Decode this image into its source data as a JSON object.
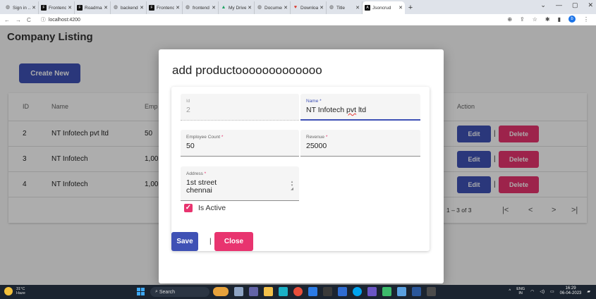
{
  "browser": {
    "tabs": [
      {
        "title": "Sign in ...",
        "icon": "globe-icon"
      },
      {
        "title": "Frontend",
        "icon": "square-logo-icon"
      },
      {
        "title": "Roadmap",
        "icon": "square-logo-icon"
      },
      {
        "title": "backend",
        "icon": "globe-icon"
      },
      {
        "title": "Frontend",
        "icon": "square-logo-icon"
      },
      {
        "title": "frontend",
        "icon": "globe-icon"
      },
      {
        "title": "My Drive",
        "icon": "drive-icon"
      },
      {
        "title": "Documen",
        "icon": "globe-icon"
      },
      {
        "title": "Downloa",
        "icon": "heart-icon"
      },
      {
        "title": "Title",
        "icon": "globe-icon"
      },
      {
        "title": "Jsoncrud",
        "icon": "angular-icon",
        "active": true
      }
    ],
    "url": "localhost:4200",
    "profile_initial": "b"
  },
  "page": {
    "title": "Company Listing",
    "create_label": "Create New"
  },
  "table": {
    "headers": {
      "id": "ID",
      "name": "Name",
      "emp": "Emp",
      "action": "Action"
    },
    "rows": [
      {
        "id": "2",
        "name": "NT Infotech pvt ltd",
        "emp": "50"
      },
      {
        "id": "3",
        "name": "NT Infotech",
        "emp": "1,00"
      },
      {
        "id": "4",
        "name": "NT Infotech",
        "emp": "1,00"
      }
    ],
    "edit_label": "Edit",
    "delete_label": "Delete",
    "separator": "|",
    "range": "1 – 3 of 3",
    "pager": {
      "first": "|<",
      "prev": "<",
      "next": ">",
      "last": ">|"
    }
  },
  "dialog": {
    "title": "add productooooooooooooo",
    "fields": {
      "id": {
        "label": "Id",
        "value": "2"
      },
      "name": {
        "label": "Name",
        "value_plain": "NT Infotech ",
        "value_marked": "pvt",
        "value_tail": " ltd"
      },
      "employee_count": {
        "label": "Employee Count",
        "value": "50"
      },
      "revenue": {
        "label": "Revenue",
        "value": "25000"
      },
      "address": {
        "label": "Address",
        "line1": "1st street",
        "line2": "chennai"
      }
    },
    "required_mark": "*",
    "checkbox": {
      "label": "Is Active",
      "checked": true
    },
    "save_label": "Save",
    "separator": "|",
    "close_label": "Close"
  },
  "taskbar": {
    "weather_temp": "31°C",
    "weather_desc": "Haze",
    "search_label": "Search",
    "lang_top": "ENG",
    "lang_bottom": "IN",
    "time": "16:29",
    "date": "06-04-2023"
  },
  "colors": {
    "primary": "#3f51b5",
    "accent": "#e8346f"
  }
}
